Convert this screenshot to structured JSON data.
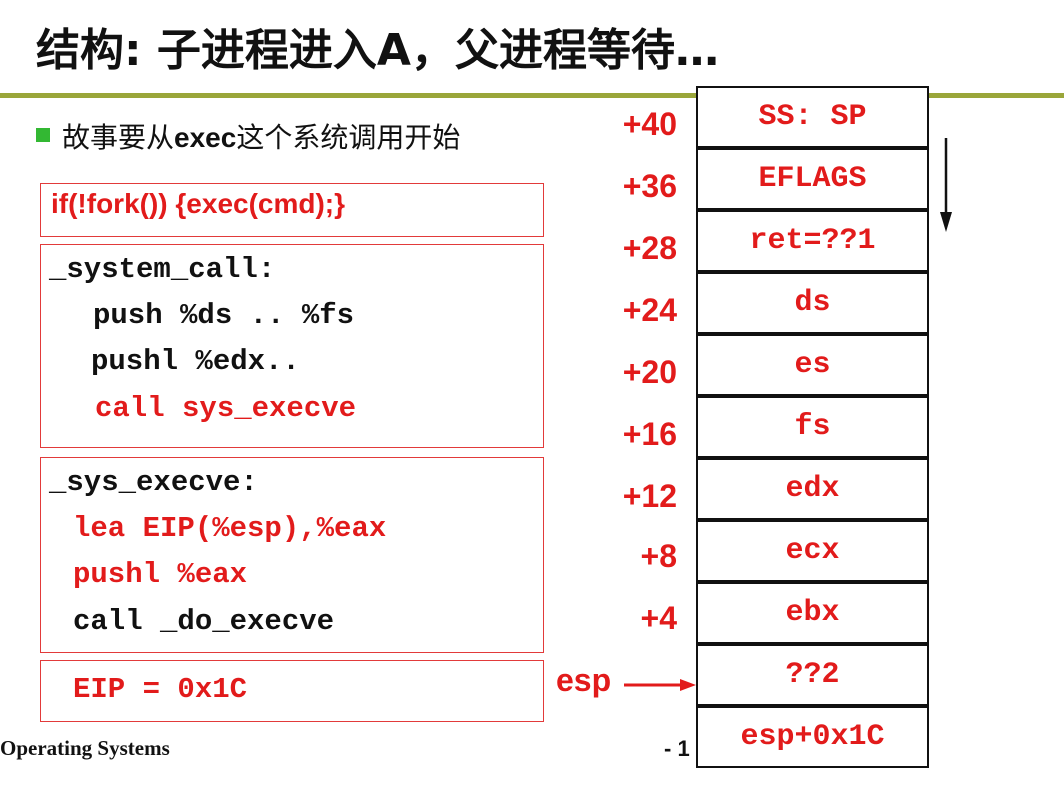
{
  "slide": {
    "title": "结构: 子进程进入A，父进程等待…",
    "bullet": {
      "pre": "故事要从",
      "bold": "exec",
      "post": "这个系统调用开始"
    },
    "fork_line": "if(!fork()) {exec(cmd);}",
    "system_call": {
      "label": "_system_call:",
      "line1": "push %ds .. %fs",
      "line2": "pushl %edx..",
      "line3": "call sys_execve"
    },
    "sys_execve": {
      "label": "_sys_execve:",
      "line1": "lea EIP(%esp),%eax",
      "line2": "pushl %eax",
      "line3": "call _do_execve"
    },
    "eip_line": "EIP = 0x1C",
    "offsets": [
      "+40",
      "+36",
      "+28",
      "+24",
      "+20",
      "+16",
      "+12",
      "+8",
      "+4"
    ],
    "stack_cells": [
      "SS: SP",
      "EFLAGS",
      "ret=??1",
      "ds",
      "es",
      "fs",
      "edx",
      "ecx",
      "ebx",
      "??2",
      "esp+0x1C"
    ],
    "esp_label": "esp",
    "footer_left": "Operating Systems",
    "footer_num": "- 1"
  },
  "colors": {
    "accent_red": "#e21b1b",
    "rule": "#9aa63a",
    "bullet": "#33b833"
  }
}
